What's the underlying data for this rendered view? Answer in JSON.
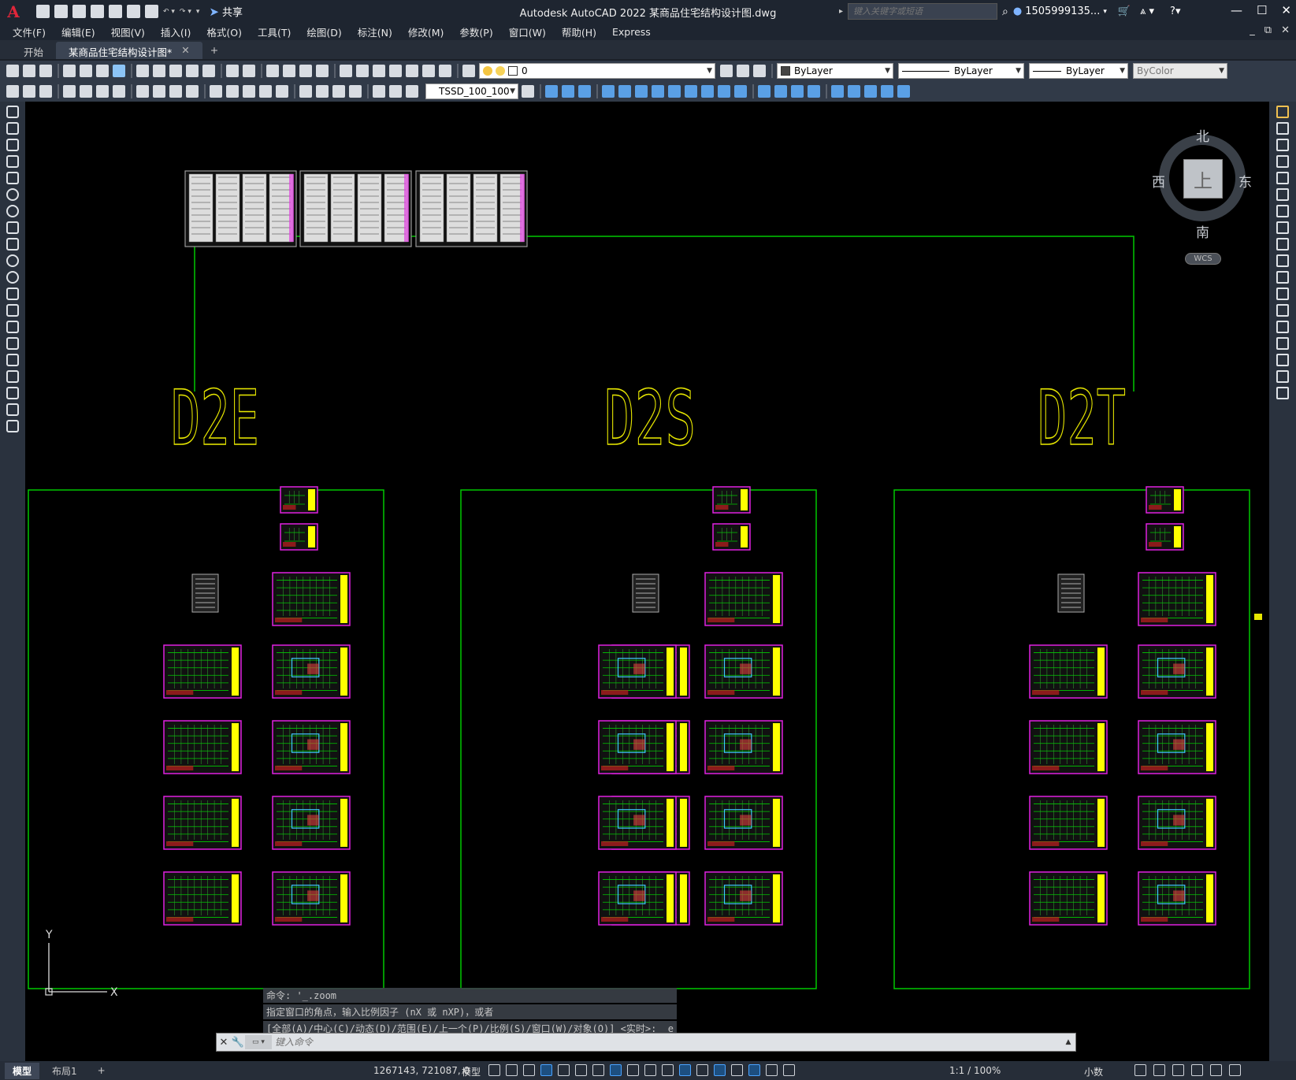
{
  "window": {
    "title": "Autodesk AutoCAD 2022    某商品住宅结构设计图.dwg",
    "search_placeholder": "键入关键字或短语",
    "username": "1505999135...",
    "share_label": "共享"
  },
  "menu": [
    "文件(F)",
    "编辑(E)",
    "视图(V)",
    "插入(I)",
    "格式(O)",
    "工具(T)",
    "绘图(D)",
    "标注(N)",
    "修改(M)",
    "参数(P)",
    "窗口(W)",
    "帮助(H)",
    "Express"
  ],
  "file_tabs": {
    "start": "开始",
    "active": "某商品住宅结构设计图*",
    "add": "+"
  },
  "toolbar": {
    "layer_value": "0",
    "color_value": "ByLayer",
    "linetype_value": "ByLayer",
    "lineweight_value": "ByLayer",
    "plotstyle_value": "ByColor",
    "dimstyle_value": "TSSD_100_100"
  },
  "viewcube": {
    "north": "北",
    "south": "南",
    "east": "东",
    "west": "西",
    "face": "上",
    "wcs": "WCS"
  },
  "drawing": {
    "group_labels": [
      "D2E",
      "D2S",
      "D2T"
    ],
    "colors": {
      "frame": "#00c800",
      "label": "#e6e600",
      "sheet_border": "#e020e0",
      "sheet_fill": "#00cc00",
      "title_block": "#ffff00"
    }
  },
  "ucs": {
    "x": "X",
    "y": "Y"
  },
  "command": {
    "history": [
      "命令: '_.zoom",
      "指定窗口的角点，输入比例因子 (nX 或 nXP)，或者",
      "[全部(A)/中心(C)/动态(D)/范围(E)/上一个(P)/比例(S)/窗口(W)/对象(O)] <实时>: _e"
    ],
    "placeholder": "键入命令"
  },
  "status": {
    "layout_tabs": [
      "模型",
      "布局1"
    ],
    "add": "+",
    "coordinates": "1267143, 721087, 0",
    "space": "模型",
    "annotation_scale": "1:1 / 100%",
    "units": "小数"
  }
}
